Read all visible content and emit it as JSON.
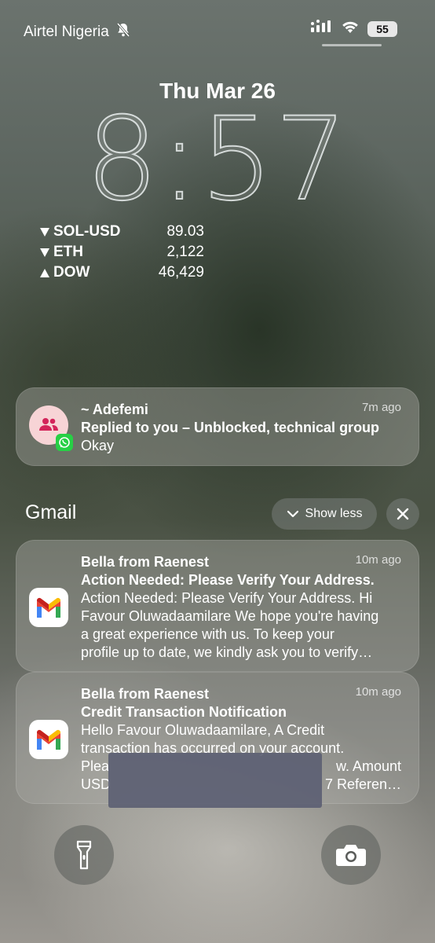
{
  "status_bar": {
    "carrier": "Airtel Nigeria",
    "battery": "55",
    "icons": [
      "bell-slash-icon",
      "signal-icon",
      "wifi-icon",
      "battery-icon"
    ]
  },
  "lock_screen": {
    "date": "Thu Mar 26",
    "time": "8:57"
  },
  "stocks": [
    {
      "symbol": "SOL-USD",
      "direction": "down",
      "value": "89.03"
    },
    {
      "symbol": "ETH",
      "direction": "down",
      "value": "2,122"
    },
    {
      "symbol": "DOW",
      "direction": "up",
      "value": "46,429"
    }
  ],
  "whatsapp_notification": {
    "sender": "~ Adefemi",
    "time_ago": "7m ago",
    "subtitle": "Replied to you – Unblocked, technical group",
    "body": "Okay"
  },
  "gmail_group": {
    "title": "Gmail",
    "show_less": "Show less",
    "notifications": [
      {
        "sender": "Bella from Raenest",
        "time_ago": "10m ago",
        "subject": "Action Needed: Please Verify Your Address.",
        "body_lines": [
          "Action Needed: Please Verify Your Address. Hi",
          "Favour Oluwadaamilare We hope you're having",
          "a great experience with us. To keep your",
          "profile up to date, we kindly ask you to verify…"
        ]
      },
      {
        "sender": "Bella from Raenest",
        "time_ago": "10m ago",
        "subject": "Credit Transaction Notification",
        "body_lines": [
          "Hello Favour Oluwadaamilare, A Credit",
          "transaction has occurred on your account.",
          "Plea",
          "USD",
          "w. Amount",
          "7 Referen…"
        ]
      }
    ]
  },
  "bottom_controls": {
    "left": "flashlight-icon",
    "right": "camera-icon"
  },
  "colors": {
    "whatsapp_green": "#27d045",
    "gmail_red": "#ea4335"
  }
}
